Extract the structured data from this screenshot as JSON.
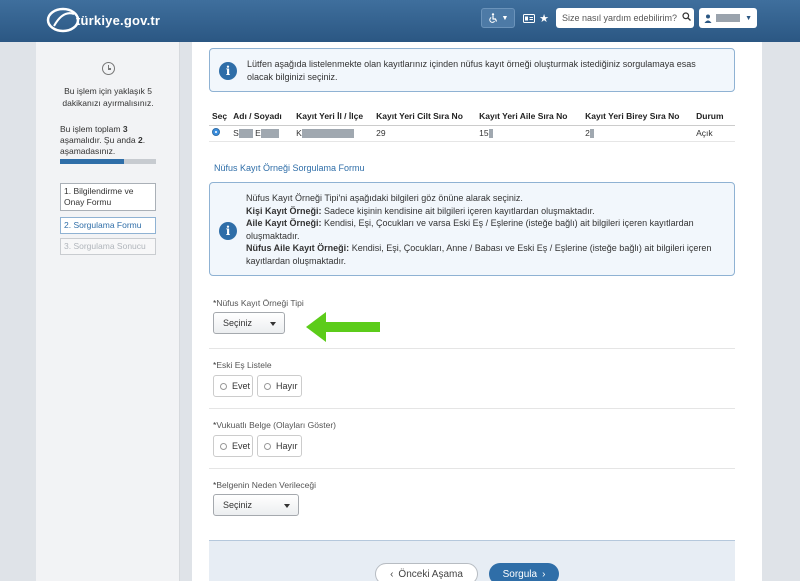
{
  "header": {
    "logo_text": "türkiye.gov.tr",
    "search_placeholder": "Size nasıl yardım edebilirim?",
    "accessibility_icon": "wheelchair-icon",
    "card_icon": "id-card-icon",
    "star_icon": "star-icon",
    "user_icon": "user-icon"
  },
  "sidebar": {
    "time_note": "Bu işlem için yaklaşık 5 dakikanızı ayırmalısınız.",
    "steps_note_pre": "Bu işlem toplam ",
    "steps_total": "3",
    "steps_note_mid": " aşamalıdır. Şu anda ",
    "steps_current": "2",
    "steps_note_post": ". aşamadasınız.",
    "progress_fraction": 0.67,
    "steps": [
      {
        "label": "1. Bilgilendirme ve Onay Formu"
      },
      {
        "label": "2. Sorgulama Formu"
      },
      {
        "label": "3. Sorgulama Sonucu"
      }
    ]
  },
  "main": {
    "intro_text": "Lütfen aşağıda listelenmekte olan kayıtlarınız içinden nüfus kayıt örneği oluşturmak istediğiniz sorgulamaya esas olacak bilginizi seçiniz.",
    "table": {
      "headers": [
        "Seç",
        "Adı / Soyadı",
        "Kayıt Yeri İl / İlçe",
        "Kayıt Yeri Cilt Sıra No",
        "Kayıt Yeri Aile Sıra No",
        "Kayıt Yeri Birey Sıra No",
        "Durum"
      ],
      "row": {
        "name_prefix": "S",
        "name_mid": "E",
        "place_prefix": "K",
        "cilt": "29",
        "aile": "15",
        "birey": "2",
        "status": "Açık"
      }
    },
    "form_title": "Nüfus Kayıt Örneği Sorgulama Formu",
    "info": {
      "line1": "Nüfus Kayıt Örneği Tipi'ni aşağıdaki bilgileri göz önüne alarak seçiniz.",
      "kisi_label": "Kişi Kayıt Örneği:",
      "kisi_text": " Sadece kişinin kendisine ait bilgileri içeren kayıtlardan oluşmaktadır.",
      "aile_label": "Aile Kayıt Örneği:",
      "aile_text": " Kendisi, Eşi, Çocukları ve varsa Eski Eş / Eşlerine (isteğe bağlı) ait bilgileri içeren kayıtlardan oluşmaktadır.",
      "nufus_label": "Nüfus Aile Kayıt Örneği:",
      "nufus_text": " Kendisi, Eşi, Çocukları, Anne / Babası ve Eski Eş / Eşlerine (isteğe bağlı) ait bilgileri içeren kayıtlardan oluşmaktadır."
    },
    "fields": {
      "tip_label": "Nüfus Kayıt Örneği Tipi",
      "tip_value": "Seçiniz",
      "eski_es_label": "Eski Eş Listele",
      "vukuatli_label": "Vukuatlı Belge (Olayları Göster)",
      "neden_label": "Belgenin Neden Verileceği",
      "neden_value": "Seçiniz",
      "required_mark": "*",
      "yes": "Evet",
      "no": "Hayır"
    },
    "buttons": {
      "prev": "Önceki Aşama",
      "next": "Sorgula"
    }
  },
  "colors": {
    "header": "#2b5783",
    "accent": "#2f6ea8",
    "arrow": "#5ccc1a"
  }
}
